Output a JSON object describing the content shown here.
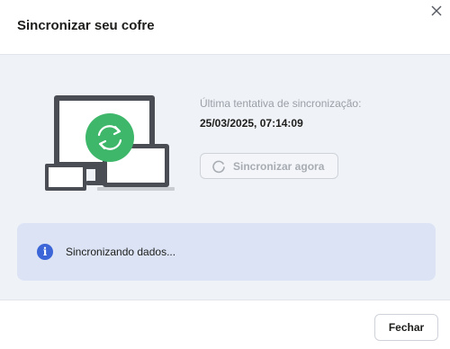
{
  "dialog": {
    "title": "Sincronizar seu cofre",
    "close_icon": "close-icon"
  },
  "sync": {
    "last_attempt_label": "Última tentativa de sincronização:",
    "last_attempt_value": "25/03/2025, 07:14:09",
    "sync_now_label": "Sincronizar agora",
    "sync_now_enabled": false
  },
  "info": {
    "icon": "info-icon",
    "message": "Sincronizando dados..."
  },
  "footer": {
    "close_label": "Fechar"
  },
  "colors": {
    "accent_green": "#3fb76b",
    "device_dark": "#4a4e54",
    "info_blue": "#3c66d8",
    "info_background": "#dbe3f5"
  }
}
